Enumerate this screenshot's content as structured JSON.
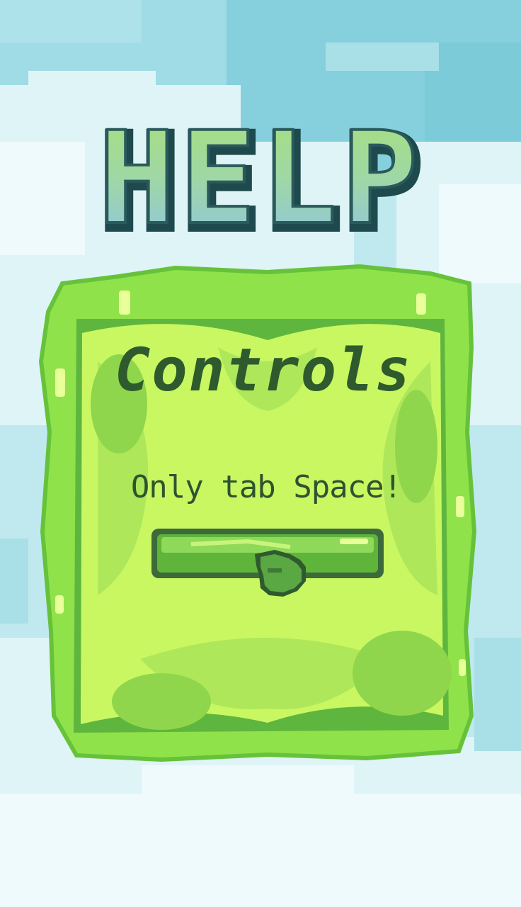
{
  "title": "HELP",
  "heading": "Controls",
  "instruction": "Only tab Space!",
  "colors": {
    "sky": "#8fd6e0",
    "cloud": "#e6f7f8",
    "slime": "#8be04e",
    "slime_light": "#d2fa6a",
    "slime_dark": "#3f8a3a",
    "outline": "#2c5537",
    "title_top": "#a8e07a",
    "title_bottom": "#8cc3e6"
  },
  "icons": {
    "key": "spacebar-key-icon",
    "hand": "pointing-hand-icon"
  }
}
